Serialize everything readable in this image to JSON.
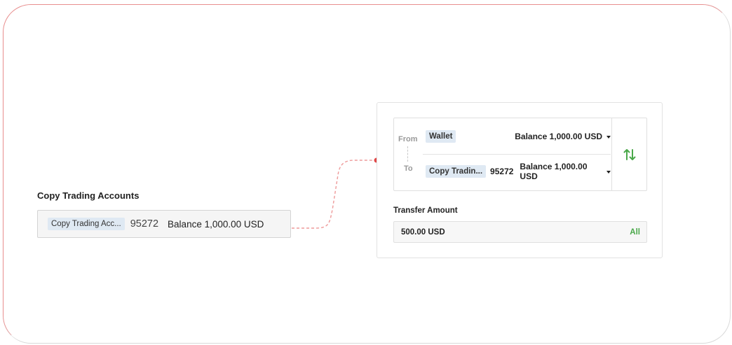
{
  "left_panel": {
    "title": "Copy Trading Accounts",
    "account_chip": "Copy Trading Acc...",
    "account_id": "95272",
    "balance_text": "Balance 1,000.00 USD"
  },
  "transfer": {
    "from_label": "From",
    "to_label": "To",
    "from_account": "Wallet",
    "from_balance": "Balance 1,000.00 USD",
    "to_account": "Copy Tradin...",
    "to_account_id": "95272",
    "to_balance": "Balance 1,000.00 USD",
    "swap_icon": "swap-vertical-icon"
  },
  "amount": {
    "label": "Transfer Amount",
    "value": "500.00 USD",
    "all_label": "All"
  },
  "colors": {
    "accent_green": "#4aa84a",
    "connector_red": "#e04848",
    "chip_bg": "#dfe9f3"
  }
}
